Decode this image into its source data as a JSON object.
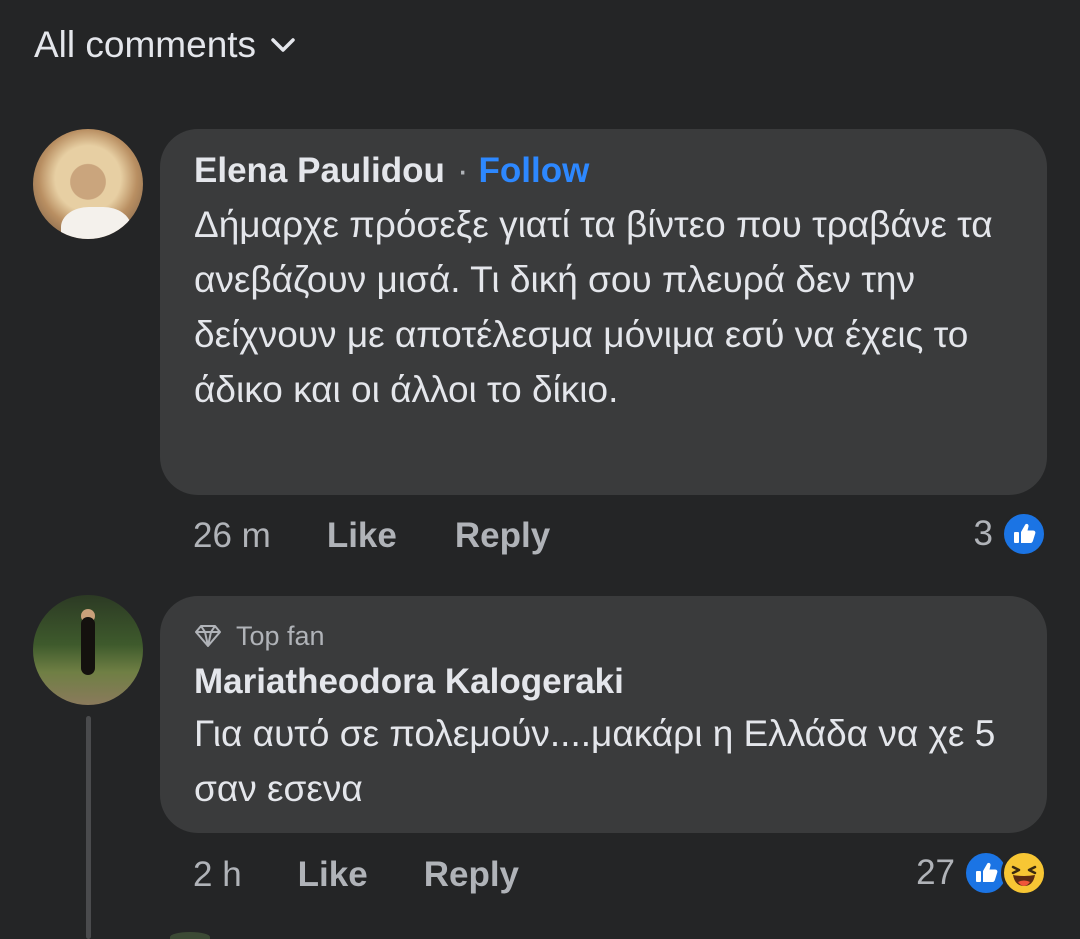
{
  "header": {
    "filter_label": "All comments"
  },
  "comments": [
    {
      "author": "Elena Paulidou",
      "separator": "·",
      "follow_label": "Follow",
      "text": "Δήμαρχε πρόσεξε γιατί τα βίντεο που τραβάνε τα ανεβάζουν μισά. Τι δική σου πλευρά δεν την δείχνουν με αποτέλεσμα μόνιμα εσύ να έχεις το άδικο και οι άλλοι το δίκιο.",
      "time": "26 m",
      "like_label": "Like",
      "reply_label": "Reply",
      "reaction_count": "3"
    },
    {
      "badge": "Top fan",
      "author": "Mariatheodora Kalogeraki",
      "text": "Για αυτό σε πολεμούν....μακάρι η Ελλάδα να χε 5 σαν εσενα",
      "time": "2 h",
      "like_label": "Like",
      "reply_label": "Reply",
      "reaction_count": "27"
    }
  ],
  "colors": {
    "background": "#242526",
    "bubble": "#3a3b3c",
    "follow": "#2d88ff",
    "like_reaction": "#1b74e4",
    "haha_reaction": "#f7c634"
  },
  "icons": {
    "filter": "chevron-down-icon",
    "badge": "diamond-icon",
    "like": "thumbs-up-icon",
    "haha": "laughing-face-icon"
  }
}
